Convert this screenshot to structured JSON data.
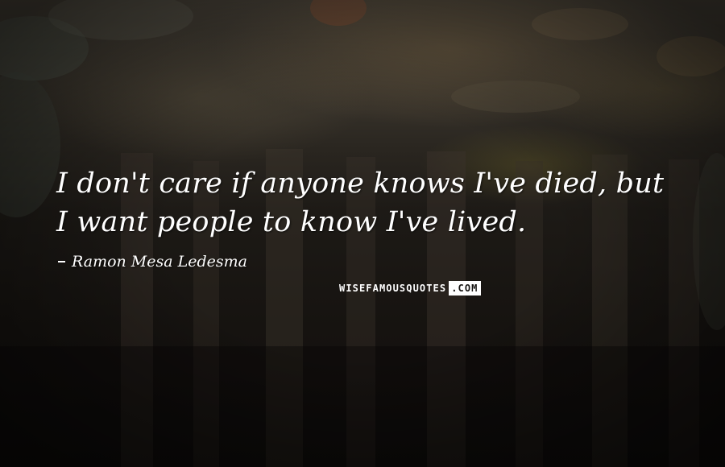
{
  "quote": {
    "line1": "I don't care if anyone knows I've died, but",
    "line2": "I want people to know I've lived."
  },
  "author": "Ramon Mesa Ledesma",
  "watermark": {
    "main": "WISEFAMOUSQUOTES",
    "tld": ".COM"
  },
  "colors": {
    "text": "#ffffff",
    "background": "#141210"
  }
}
